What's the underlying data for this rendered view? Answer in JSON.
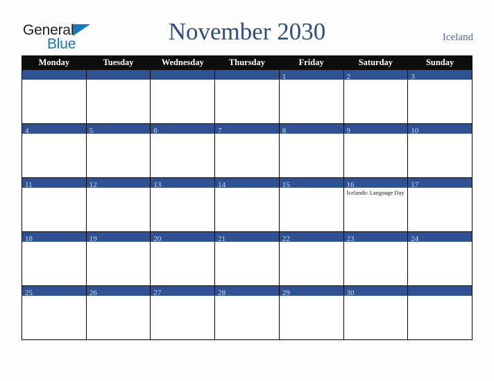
{
  "brand": {
    "name_part1": "General",
    "name_part2": "Blue",
    "triangle_color": "#1878be"
  },
  "header": {
    "title": "November 2030",
    "country": "Iceland",
    "title_color": "#2e4e7e",
    "country_color": "#516c99"
  },
  "theme": {
    "page_background": "#fdfdfd",
    "weekday_header_background": "#0d0d0d",
    "weekday_header_text": "#ffffff",
    "date_band_background": "#2e5294",
    "date_number_text": "#d9dee8",
    "cell_background": "#ffffff",
    "grid_line": "#000000"
  },
  "weekdays": [
    "Monday",
    "Tuesday",
    "Wednesday",
    "Thursday",
    "Friday",
    "Saturday",
    "Sunday"
  ],
  "weeks": [
    [
      {
        "day": "",
        "events": []
      },
      {
        "day": "",
        "events": []
      },
      {
        "day": "",
        "events": []
      },
      {
        "day": "",
        "events": []
      },
      {
        "day": "1",
        "events": []
      },
      {
        "day": "2",
        "events": []
      },
      {
        "day": "3",
        "events": []
      }
    ],
    [
      {
        "day": "4",
        "events": []
      },
      {
        "day": "5",
        "events": []
      },
      {
        "day": "6",
        "events": []
      },
      {
        "day": "7",
        "events": []
      },
      {
        "day": "8",
        "events": []
      },
      {
        "day": "9",
        "events": []
      },
      {
        "day": "10",
        "events": []
      }
    ],
    [
      {
        "day": "11",
        "events": []
      },
      {
        "day": "12",
        "events": []
      },
      {
        "day": "13",
        "events": []
      },
      {
        "day": "14",
        "events": []
      },
      {
        "day": "15",
        "events": []
      },
      {
        "day": "16",
        "events": [
          "Icelandic Language Day"
        ]
      },
      {
        "day": "17",
        "events": []
      }
    ],
    [
      {
        "day": "18",
        "events": []
      },
      {
        "day": "19",
        "events": []
      },
      {
        "day": "20",
        "events": []
      },
      {
        "day": "21",
        "events": []
      },
      {
        "day": "22",
        "events": []
      },
      {
        "day": "23",
        "events": []
      },
      {
        "day": "24",
        "events": []
      }
    ],
    [
      {
        "day": "25",
        "events": []
      },
      {
        "day": "26",
        "events": []
      },
      {
        "day": "27",
        "events": []
      },
      {
        "day": "28",
        "events": []
      },
      {
        "day": "29",
        "events": []
      },
      {
        "day": "30",
        "events": []
      },
      {
        "day": "",
        "events": []
      }
    ]
  ]
}
